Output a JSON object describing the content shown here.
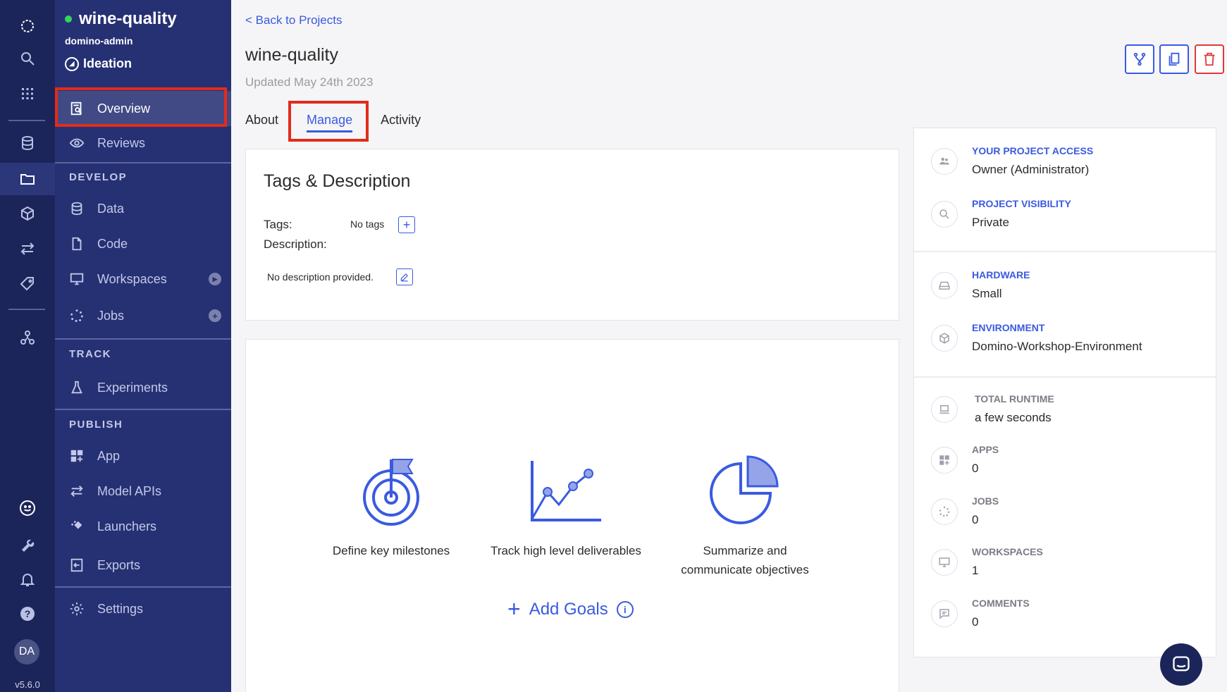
{
  "rail": {
    "version": "v5.6.0",
    "avatar_initials": "DA",
    "icons": [
      "domino-logo-icon",
      "search-icon",
      "apps-grid-icon",
      "data-icon",
      "projects-folder-icon",
      "model-box-icon",
      "transfer-icon",
      "tag-icon",
      "org-icon",
      "feedback-smiley-icon",
      "wrench-icon",
      "bell-icon",
      "help-icon"
    ]
  },
  "project": {
    "name": "wine-quality",
    "owner": "domino-admin",
    "stage": "Ideation",
    "status_color": "#34d65e"
  },
  "nav": {
    "overview": "Overview",
    "reviews": "Reviews",
    "develop_header": "DEVELOP",
    "data": "Data",
    "code": "Code",
    "workspaces": "Workspaces",
    "jobs": "Jobs",
    "track_header": "TRACK",
    "experiments": "Experiments",
    "publish_header": "PUBLISH",
    "app": "App",
    "model_apis": "Model APIs",
    "launchers": "Launchers",
    "exports": "Exports",
    "settings": "Settings"
  },
  "main": {
    "back_link": "< Back to Projects",
    "title": "wine-quality",
    "updated": "Updated May 24th 2023",
    "tabs": [
      {
        "label": "About",
        "active": false
      },
      {
        "label": "Manage",
        "active": true
      },
      {
        "label": "Activity",
        "active": false
      }
    ],
    "tags_card": {
      "heading": "Tags & Description",
      "tags_label": "Tags:",
      "no_tags": "No tags",
      "description_label": "Description:",
      "no_description": "No description provided."
    },
    "goals": {
      "items": [
        "Define key milestones",
        "Track high level deliverables",
        "Summarize and communicate objectives"
      ],
      "add_label": "Add Goals"
    }
  },
  "right_panel": {
    "project_access_label": "YOUR PROJECT ACCESS",
    "project_access_value": "Owner (Administrator)",
    "visibility_label": "PROJECT VISIBILITY",
    "visibility_value": "Private",
    "hardware_label": "HARDWARE",
    "hardware_value": "Small",
    "environment_label": "ENVIRONMENT",
    "environment_value": "Domino-Workshop-Environment",
    "runtime_label": "TOTAL RUNTIME",
    "runtime_value": "a few seconds",
    "apps_label": "APPS",
    "apps_value": "0",
    "jobs_label": "JOBS",
    "jobs_value": "0",
    "workspaces_label": "WORKSPACES",
    "workspaces_value": "1",
    "comments_label": "COMMENTS",
    "comments_value": "0"
  },
  "colors": {
    "rail_bg": "#1c2559",
    "sidebar_bg": "#253173",
    "accent": "#3a5ae0",
    "highlight": "#e32b1a",
    "danger": "#e0383a"
  }
}
